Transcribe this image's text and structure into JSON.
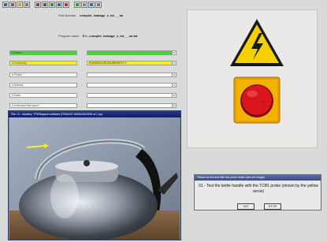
{
  "header": {
    "part_number_label": "Part Number",
    "part_number_value": "complet_leakage_s_tst___ok",
    "program_name_label": "Program name",
    "program_name_value": "E:\\...complet_leakage_s_tst___ok.tst"
  },
  "toolbar": {
    "buttons": [
      {
        "icon": "save-icon",
        "color": "#3b5bb5"
      },
      {
        "icon": "print-icon",
        "color": "#666666"
      },
      {
        "icon": "open-icon",
        "color": "#c9a227"
      },
      {
        "icon": "copy-icon",
        "color": "#777777"
      },
      {
        "icon": "tool-icon",
        "color": "#9c3c3c"
      },
      {
        "icon": "sum-icon",
        "color": "#555555"
      },
      {
        "icon": "chart-icon",
        "color": "#3b8a3b"
      },
      {
        "icon": "user-icon",
        "color": "#2f6fc0"
      },
      {
        "icon": "flag-icon",
        "color": "#c03030"
      },
      {
        "icon": "check-icon",
        "color": "#2e9a2e"
      },
      {
        "icon": "gear-icon",
        "color": "#888888"
      },
      {
        "icon": "help-icon",
        "color": "#2f6fc0"
      },
      {
        "icon": "grid-icon",
        "color": "#777777"
      }
    ]
  },
  "rows": [
    {
      "label": "0 Status",
      "value": "",
      "color": "#4cd137"
    },
    {
      "label": "# Continuity",
      "value": "RUNNING MEASUREMENT 0",
      "color": "#f7f024"
    },
    {
      "label": "# Phase",
      "value": "",
      "color": ""
    },
    {
      "label": "# Neutral",
      "value": "",
      "color": ""
    },
    {
      "label": "# Earth",
      "value": "",
      "color": ""
    },
    {
      "label": "# Extended test report",
      "value": "",
      "color": ""
    }
  ],
  "camera": {
    "title": "File • 5 - Industry: TP5/Rapport software (FRANCE 50009/16/2008 at 1 pa)"
  },
  "dialog": {
    "title": "Please do the test with the probe tester (see the image)",
    "message": "01 - Test the kettle handle with the TCB1 probe (shown by the yellow arrow)",
    "go_label": "GO",
    "stop_label": "STOP"
  },
  "colors": {
    "warning_yellow": "#f5d000",
    "estop_red": "#d8161c",
    "estop_base": "#e8a000"
  }
}
